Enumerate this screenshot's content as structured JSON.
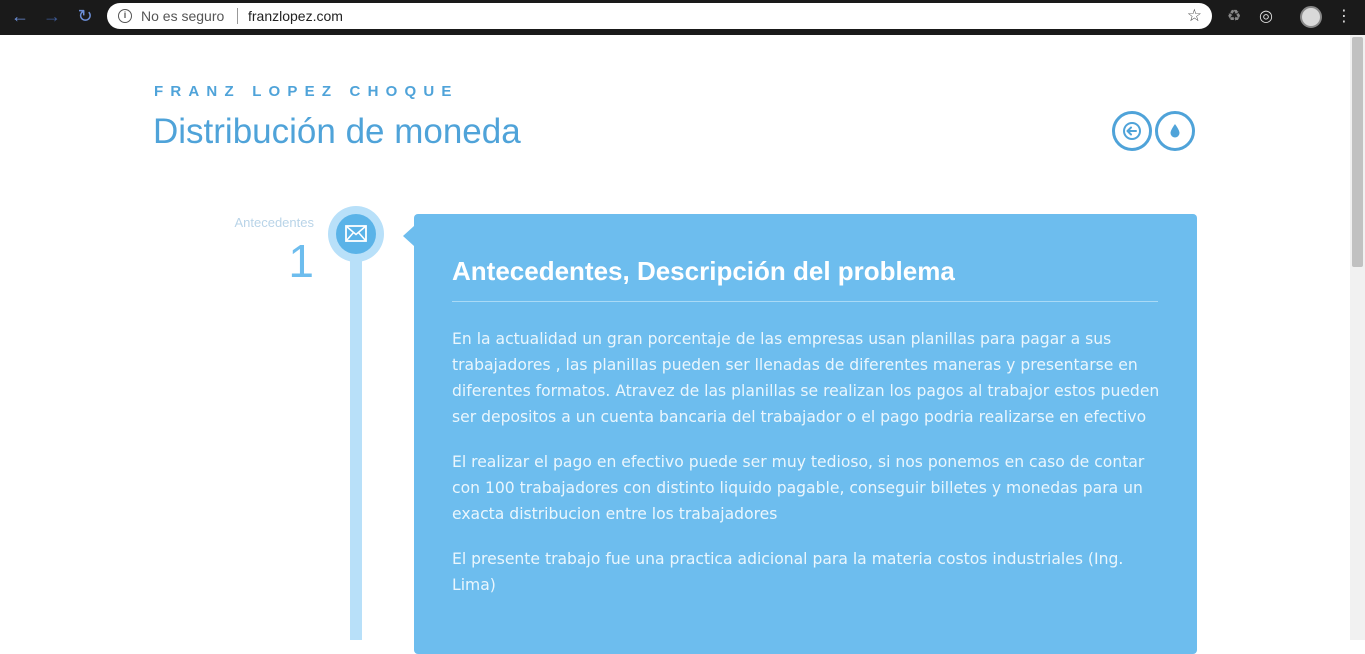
{
  "browser": {
    "security_label": "No es seguro",
    "url": "franzlopez.com"
  },
  "header": {
    "author": "FRANZ LOPEZ CHOQUE",
    "title": "Distribución de moneda"
  },
  "timeline": {
    "step_label": "Antecedentes",
    "step_number": "1"
  },
  "card": {
    "title": "Antecedentes, Descripción del problema",
    "paragraphs": [
      "En la actualidad un gran porcentaje de las empresas usan planillas para pagar a sus trabajadores , las planillas pueden ser llenadas de diferentes maneras y presentarse en diferentes formatos. Atravez de las planillas se realizan los pagos al trabajor estos pueden ser depositos a un cuenta bancaria del trabajador o el pago podria realizarse en efectivo",
      "El realizar el pago en efectivo puede ser muy tedioso, si nos ponemos en caso de contar con 100 trabajadores con distinto liquido pagable, conseguir billetes y monedas para un exacta distribucion entre los trabajadores",
      "El presente trabajo fue una practica adicional para la materia costos industriales (Ing. Lima)"
    ]
  },
  "colors": {
    "accent": "#4fa3d9",
    "card_bg": "#6dbdee",
    "timeline_light": "#b8e0f9"
  },
  "icons": {
    "back": "arrow-left-icon",
    "theme": "water-drop-icon",
    "timeline": "envelope-icon"
  }
}
